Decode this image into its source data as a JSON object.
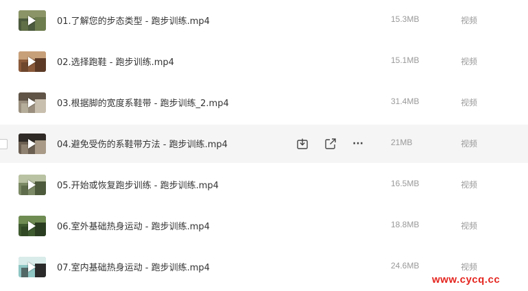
{
  "files": [
    {
      "name": "01.了解您的步态类型 - 跑步训练.mp4",
      "size": "15.3MB",
      "type": "视频",
      "thumb_icon": "video-thumbnail-park-runner",
      "colors": [
        "#4c5a3d",
        "#8a9466",
        "#6e7d4e"
      ]
    },
    {
      "name": "02.选择跑鞋 - 跑步训练.mp4",
      "size": "15.1MB",
      "type": "视频",
      "thumb_icon": "video-thumbnail-shoe-store",
      "colors": [
        "#8a5a3b",
        "#c7a07a",
        "#5c3a26"
      ]
    },
    {
      "name": "03.根据脚的宽度系鞋带 - 跑步训练_2.mp4",
      "size": "31.4MB",
      "type": "视频",
      "thumb_icon": "video-thumbnail-lacing-shoe",
      "colors": [
        "#9a8f7e",
        "#5f5446",
        "#c9bfae"
      ]
    },
    {
      "name": "04.避免受伤的系鞋带方法 - 跑步训练.mp4",
      "size": "21MB",
      "type": "视频",
      "thumb_icon": "video-thumbnail-shoe-closeup",
      "colors": [
        "#6b5f52",
        "#2f2a25",
        "#a89a86"
      ]
    },
    {
      "name": "05.开始或恢复跑步训练 - 跑步训练.mp4",
      "size": "16.5MB",
      "type": "视频",
      "thumb_icon": "video-thumbnail-outdoor-run",
      "colors": [
        "#7d8a66",
        "#b9c2a3",
        "#4d5a3b"
      ]
    },
    {
      "name": "06.室外基础热身运动 - 跑步训练.mp4",
      "size": "18.8MB",
      "type": "视频",
      "thumb_icon": "video-thumbnail-outdoor-warmup",
      "colors": [
        "#3e5a2f",
        "#6f8c52",
        "#2a3d20"
      ]
    },
    {
      "name": "07.室内基础热身运动 - 跑步训练.mp4",
      "size": "24.6MB",
      "type": "视频",
      "thumb_icon": "video-thumbnail-indoor-warmup",
      "colors": [
        "#8fc6c4",
        "#d9ece9",
        "#2a2a2a"
      ]
    }
  ],
  "hovered_index": 3,
  "row_actions": {
    "download_icon": "download-icon",
    "share_icon": "share-icon",
    "more_icon": "more-icon",
    "more_glyph": "···"
  },
  "watermark": "www.cycq.cc",
  "colors": {
    "hover_bg": "#f5f5f5",
    "watermark": "#e4251f",
    "meta_text": "#999999"
  }
}
